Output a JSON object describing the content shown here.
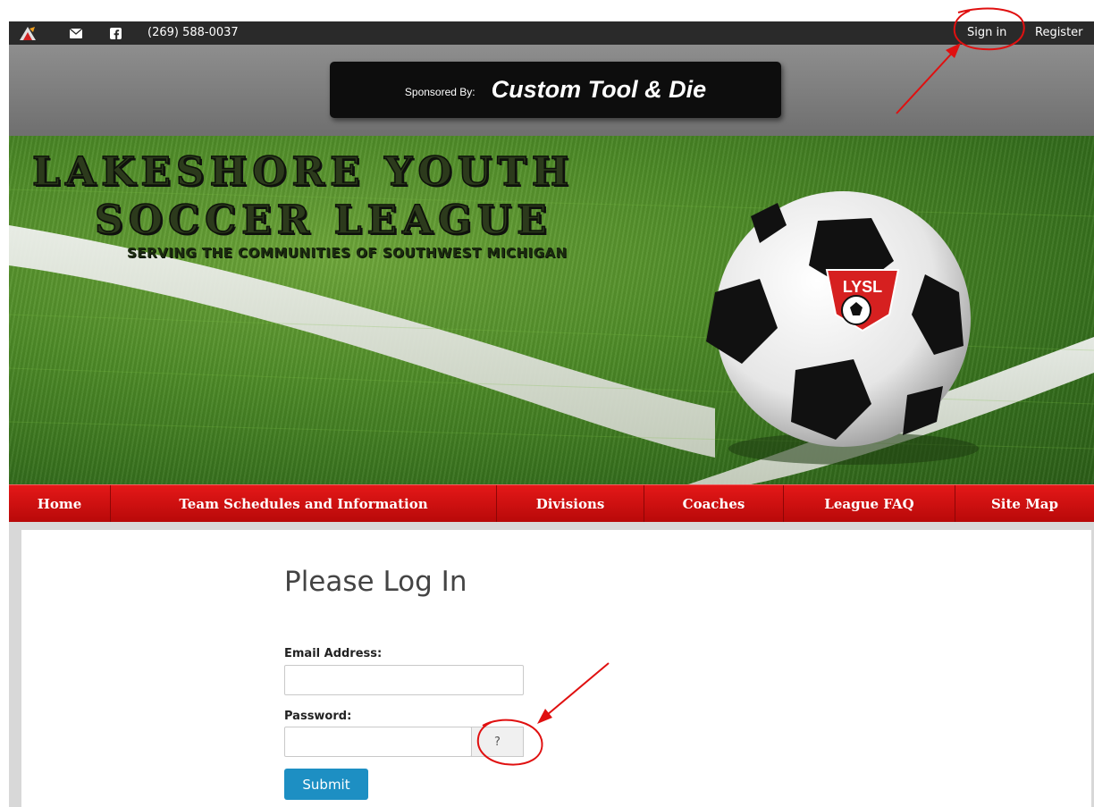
{
  "topbar": {
    "phone": "(269) 588-0037",
    "signin_label": "Sign in",
    "register_label": "Register",
    "icons": [
      "lysl-logo-icon",
      "mail-icon",
      "facebook-icon"
    ]
  },
  "sponsor": {
    "label": "Sponsored By:",
    "name": "Custom Tool & Die"
  },
  "banner": {
    "title_line1": "LAKESHORE YOUTH",
    "title_line2": "SOCCER LEAGUE",
    "subtitle": "SERVING THE COMMUNITIES OF SOUTHWEST MICHIGAN",
    "ball_badge": "LYSL"
  },
  "nav": {
    "items": [
      {
        "label": "Home"
      },
      {
        "label": "Team Schedules and Information"
      },
      {
        "label": "Divisions"
      },
      {
        "label": "Coaches"
      },
      {
        "label": "League FAQ"
      },
      {
        "label": "Site Map"
      }
    ]
  },
  "login": {
    "title": "Please Log In",
    "email_label": "Email Address:",
    "email_value": "",
    "password_label": "Password:",
    "password_value": "",
    "help_label": "?",
    "submit_label": "Submit"
  },
  "colors": {
    "nav_red": "#d41111",
    "submit_blue": "#1d8fc3",
    "annotation_red": "#e01010",
    "topbar": "#2a2a2a"
  }
}
